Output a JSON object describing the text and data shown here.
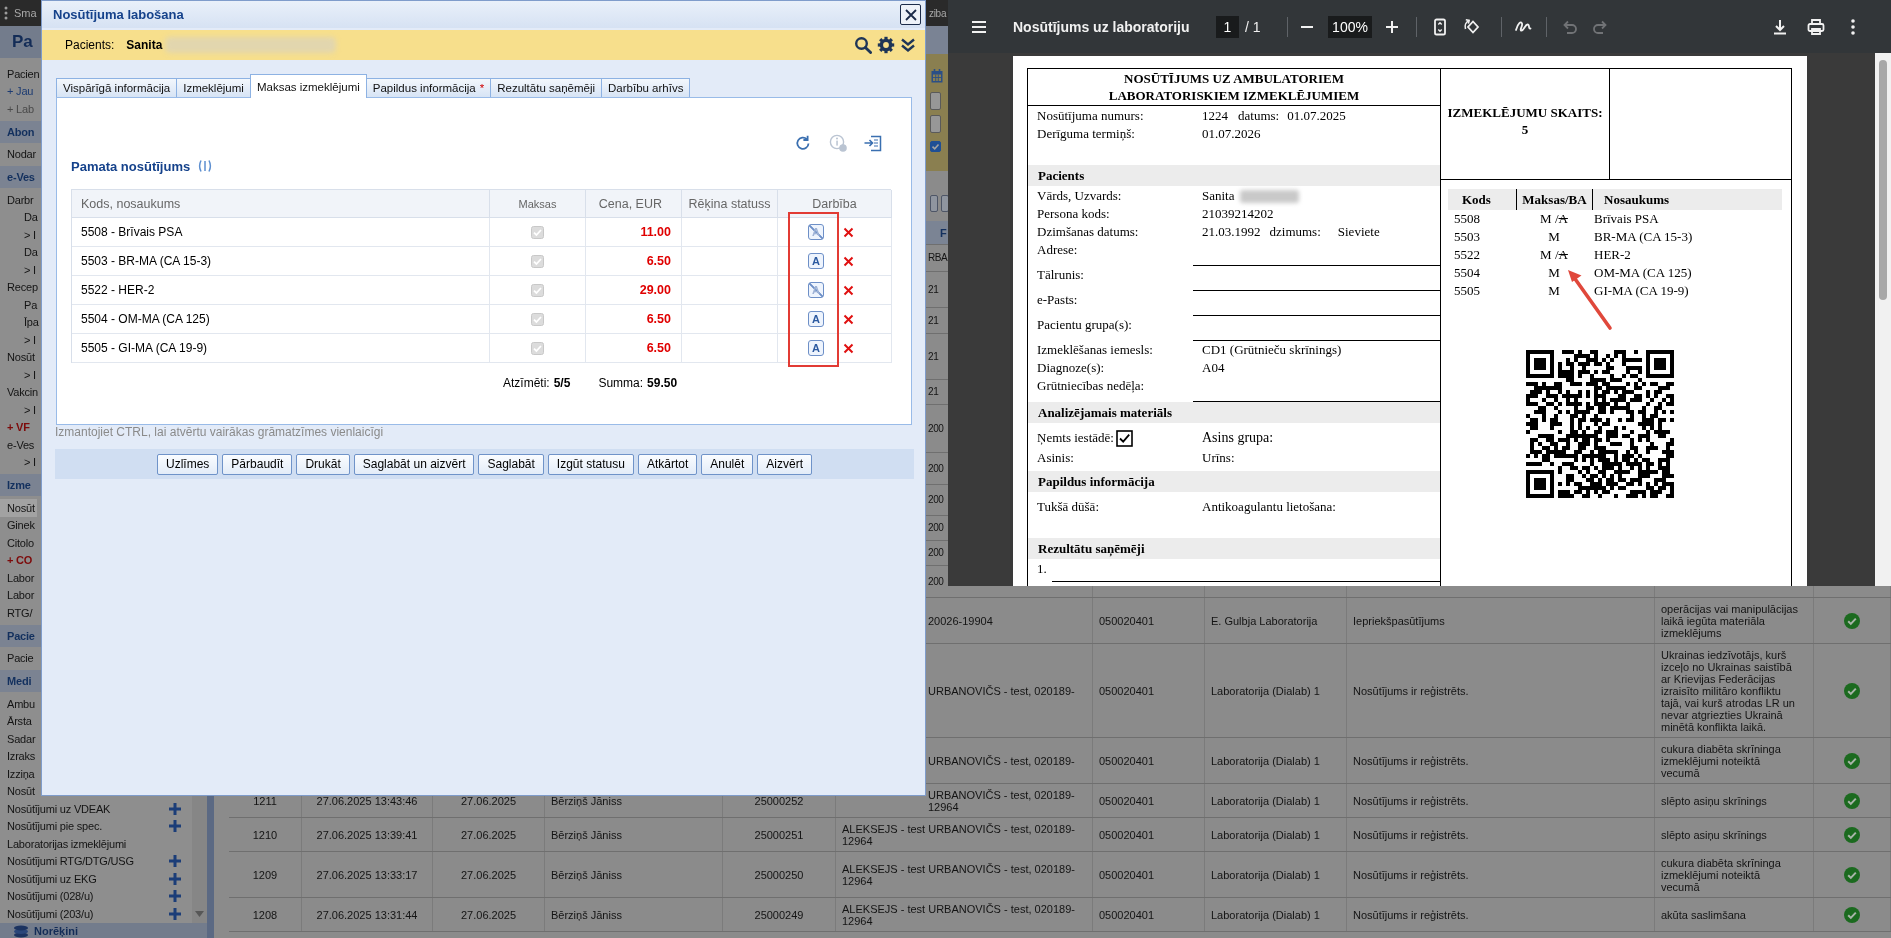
{
  "app": {
    "top_bar": {
      "title": "Sma",
      "right_text": "ziba"
    },
    "sidebar_title": "Pa",
    "sidebar": [
      {
        "text": "Pacien",
        "kind": "item",
        "selected": false
      },
      {
        "text": "+ Jau",
        "kind": "link",
        "selected": false
      },
      {
        "text": "+ Lab",
        "kind": "muted",
        "selected": false
      },
      {
        "text": "Abon",
        "kind": "header",
        "selected": false
      },
      {
        "text": "Nodar",
        "kind": "item",
        "selected": false
      },
      {
        "text": "e-Ves",
        "kind": "header",
        "selected": false
      },
      {
        "text": "Darbr",
        "kind": "item",
        "selected": false
      },
      {
        "text": "Da",
        "kind": "sub",
        "selected": false
      },
      {
        "text": "> I",
        "kind": "sub",
        "selected": false
      },
      {
        "text": "Da",
        "kind": "sub",
        "selected": false
      },
      {
        "text": "> I",
        "kind": "sub",
        "selected": false
      },
      {
        "text": "Recep",
        "kind": "item",
        "selected": false
      },
      {
        "text": "Pa",
        "kind": "sub",
        "selected": false
      },
      {
        "text": "Īpa",
        "kind": "sub",
        "selected": false
      },
      {
        "text": "> I",
        "kind": "sub",
        "selected": false
      },
      {
        "text": "Nosūt",
        "kind": "item",
        "selected": false
      },
      {
        "text": "> I",
        "kind": "sub",
        "selected": false
      },
      {
        "text": "Vakcin",
        "kind": "item",
        "selected": false
      },
      {
        "text": "> I",
        "kind": "sub",
        "selected": false
      },
      {
        "text": "+ VF",
        "kind": "alert",
        "selected": false
      },
      {
        "text": "e-Ves",
        "kind": "item",
        "selected": false
      },
      {
        "text": "> I",
        "kind": "sub",
        "selected": false
      },
      {
        "text": "Izme",
        "kind": "header",
        "selected": false
      },
      {
        "text": "Nosūt",
        "kind": "item",
        "selected": true
      },
      {
        "text": "Ginek",
        "kind": "item",
        "selected": false
      },
      {
        "text": "Citolo",
        "kind": "item",
        "selected": false
      },
      {
        "text": "+ CO",
        "kind": "alert",
        "selected": false
      },
      {
        "text": "Labor",
        "kind": "item",
        "selected": false
      },
      {
        "text": "Labor",
        "kind": "item",
        "selected": false
      },
      {
        "text": "RTG/",
        "kind": "item",
        "selected": false
      },
      {
        "text": "Pacie",
        "kind": "header",
        "selected": false
      },
      {
        "text": "Pacie",
        "kind": "item",
        "selected": false
      },
      {
        "text": "Medi",
        "kind": "header",
        "selected": false
      },
      {
        "text": "Ambu",
        "kind": "item",
        "selected": false
      },
      {
        "text": "Ārsta",
        "kind": "item",
        "selected": false
      },
      {
        "text": "Sadar",
        "kind": "item",
        "selected": false
      },
      {
        "text": "Izraks",
        "kind": "item",
        "selected": false
      },
      {
        "text": "Izziņa",
        "kind": "item",
        "selected": false
      },
      {
        "text": "Nosūt",
        "kind": "item",
        "selected": false
      },
      {
        "text": "Nosūtījumi uz VDEAK",
        "kind": "item",
        "selected": false,
        "add": true
      },
      {
        "text": "Nosūtījumi pie spec.",
        "kind": "item",
        "selected": false,
        "add": true
      },
      {
        "text": "Laboratorijas izmeklējumi",
        "kind": "item",
        "selected": false,
        "add": false
      },
      {
        "text": "Nosūtījumi RTG/DTG/USG",
        "kind": "item",
        "selected": false,
        "add": true
      },
      {
        "text": "Nosūtījumi uz EKG",
        "kind": "item",
        "selected": false,
        "add": true
      },
      {
        "text": "Nosūtījumi (028/u)",
        "kind": "item",
        "selected": false,
        "add": true
      },
      {
        "text": "Nosūtījumi (203/u)",
        "kind": "item",
        "selected": false,
        "add": true
      }
    ],
    "sidebar_footer": "Norēķini",
    "strip": {
      "checkbox_checked": true
    },
    "table_header": {
      "column_6": "F"
    },
    "table_rows": [
      {
        "kind": "covered",
        "column_6": [
          "RBA"
        ]
      },
      {
        "kind": "covered",
        "column_6": [
          "21"
        ]
      },
      {
        "kind": "covered",
        "column_6": [
          "21"
        ]
      },
      {
        "kind": "covered",
        "column_6": [
          "21"
        ]
      },
      {
        "kind": "covered",
        "column_6": [
          "21"
        ]
      },
      {
        "kind": "covered",
        "column_6": [
          "200"
        ]
      },
      {
        "kind": "covered",
        "column_6": [
          "200"
        ]
      },
      {
        "kind": "covered",
        "column_6": [
          "200"
        ]
      },
      {
        "kind": "covered",
        "column_6": [
          "200"
        ]
      },
      {
        "kind": "covered",
        "column_6": [
          "200"
        ]
      },
      {
        "kind": "covered",
        "column_6": [
          "200"
        ]
      },
      {
        "kind": "partial",
        "column_6": [
          "20026-19904"
        ],
        "column_7": "050020401",
        "column_8": "E. Gulbja Laboratorija",
        "column_9": "Iepriekšpasūtījums",
        "column_10": "operācijas vai manipulācijas laikā iegūta materiāla izmeklējums"
      },
      {
        "kind": "partial",
        "column_6": [
          "URBANOVIČS - test, 020189-"
        ],
        "column_7": "050020401",
        "column_8": "Laboratorija (Dialab) 1",
        "column_9": "Nosūtījums ir reģistrēts.",
        "column_10": "Ukrainas iedzīvotājs, kurš izceļo no Ukrainas saistībā ar Krievijas Federācijas izraisīto militāro konfliktu tajā, vai kurš atrodas LR un nevar atgriezties Ukrainā minētā konflikta laikā."
      },
      {
        "kind": "partial",
        "column_6": [
          "URBANOVIČS - test, 020189-"
        ],
        "column_7": "050020401",
        "column_8": "Laboratorija (Dialab) 1",
        "column_9": "Nosūtījums ir reģistrēts.",
        "column_10": "cukura diabēta skrīninga izmeklējumi noteiktā vecumā"
      },
      {
        "kind": "partial",
        "column_1": "1211",
        "column_2": "27.06.2025 13:43:46",
        "column_3": "27.06.2025",
        "column_4": "Bērziņš Jāniss",
        "column_5": "25000252",
        "column_6": [
          "URBANOVIČS - test, 020189-",
          "12964"
        ],
        "column_7": "050020401",
        "column_8": "Laboratorija (Dialab) 1",
        "column_9": "Nosūtījums ir reģistrēts.",
        "column_10": "slēpto asiņu skrīnings"
      },
      {
        "kind": "full",
        "column_1": "1210",
        "column_2": "27.06.2025 13:39:41",
        "column_3": "27.06.2025",
        "column_4": "Bērziņš Jāniss",
        "column_5": "25000251",
        "column_6": [
          "ALEKSEJS - test URBANOVIČS - test, 020189-",
          "12964"
        ],
        "column_7": "050020401",
        "column_8": "Laboratorija (Dialab) 1",
        "column_9": "Nosūtījums ir reģistrēts.",
        "column_10": "slēpto asiņu skrīnings"
      },
      {
        "kind": "full",
        "column_1": "1209",
        "column_2": "27.06.2025 13:33:17",
        "column_3": "27.06.2025",
        "column_4": "Bērziņš Jāniss",
        "column_5": "25000250",
        "column_6": [
          "ALEKSEJS - test URBANOVIČS - test, 020189-",
          "12964"
        ],
        "column_7": "050020401",
        "column_8": "Laboratorija (Dialab) 1",
        "column_9": "Nosūtījums ir reģistrēts.",
        "column_10": "cukura diabēta skrīninga izmeklējumi noteiktā vecumā"
      },
      {
        "kind": "full",
        "column_1": "1208",
        "column_2": "27.06.2025 13:31:44",
        "column_3": "27.06.2025",
        "column_4": "Bērziņš Jāniss",
        "column_5": "25000249",
        "column_6": [
          "ALEKSEJS - test URBANOVIČS - test, 020189-",
          "12964"
        ],
        "column_7": "050020401",
        "column_8": "Laboratorija (Dialab) 1",
        "column_9": "Nosūtījums ir reģistrēts.",
        "column_10": "akūta saslimšana"
      }
    ]
  },
  "dialog": {
    "title": "Nosūtījuma labošana",
    "patient_label": "Pacients:",
    "patient_name": "Sanita",
    "patient_surname_blurred": true,
    "tabs": [
      {
        "label": "Vispārīgā informācija",
        "selected": false
      },
      {
        "label": "Izmeklējumi",
        "selected": false
      },
      {
        "label": "Maksas izmeklējumi",
        "selected": true
      },
      {
        "label": "Papildus informācija",
        "marker": "*",
        "selected": false
      },
      {
        "label": "Rezultātu saņēmēji",
        "selected": false
      },
      {
        "label": "Darbību arhīvs",
        "selected": false
      }
    ],
    "info_disabled": true,
    "section_title": "Pamata nosūtījums",
    "columns": [
      "Kods, nosaukums",
      "Maksas",
      "Cena, EUR",
      "Rēķina statuss",
      "Darbība"
    ],
    "rows": [
      {
        "label": "5508 - Brīvais PSA",
        "checked": true,
        "disabled": true,
        "price": "11.00",
        "ba_letter": "A",
        "ba_crossed": true
      },
      {
        "label": "5503 - BR-MA (CA 15-3)",
        "checked": true,
        "disabled": true,
        "price": "6.50",
        "ba_letter": "A",
        "ba_crossed": false
      },
      {
        "label": "5522 - HER-2",
        "checked": true,
        "disabled": true,
        "price": "29.00",
        "ba_letter": "A",
        "ba_crossed": true
      },
      {
        "label": "5504 - OM-MA (CA 125)",
        "checked": true,
        "disabled": true,
        "price": "6.50",
        "ba_letter": "A",
        "ba_crossed": false
      },
      {
        "label": "5505 - GI-MA (CA 19-9)",
        "checked": true,
        "disabled": true,
        "price": "6.50",
        "ba_letter": "A",
        "ba_crossed": false
      }
    ],
    "summary": [
      {
        "label": "Atzīmēti:",
        "value": "5/5"
      },
      {
        "label": "Summa:",
        "value": "59.50"
      }
    ],
    "hint": "Izmantojiet CTRL, lai atvērtu vairākas grāmatzīmes vienlaicīgi",
    "buttons": [
      "Uzlīmes",
      "Pārbaudīt",
      "Drukāt",
      "Saglabāt un aizvērt",
      "Saglabāt",
      "Izgūt statusu",
      "Atkārtot",
      "Anulēt",
      "Aizvērt"
    ]
  },
  "pdf_viewer": {
    "title": "Nosūtījums uz laboratoriju",
    "page": "1",
    "page_total": "/ 1",
    "zoom": "100%",
    "undo_disabled": true,
    "redo_disabled": true,
    "document": {
      "title_lines": [
        "NOSŪTĪJUMS UZ AMBULATORIEM",
        "LABORATORISKIEM IZMEKLĒJUMIEM"
      ],
      "meta_rows": [
        {
          "label": "Nosūtījuma numurs:",
          "value": "1224",
          "extra_label": "datums:",
          "extra_value": "01.07.2025"
        },
        {
          "label": "Derīguma termiņš:",
          "value": "01.07.2026"
        }
      ],
      "count_label": "IZMEKLĒJUMU SKAITS:",
      "count": "5",
      "sections": [
        {
          "heading": "Pacients",
          "rows": [
            {
              "kind": "value",
              "label": "Vārds, Uzvards:",
              "value": "Sanita",
              "surname_blurred": true
            },
            {
              "kind": "value",
              "label": "Persona kods:",
              "value": "21039214202"
            },
            {
              "kind": "value",
              "label": "Dzimšanas datums:",
              "value": "21.03.1992",
              "extra_label": "dzimums:",
              "extra_value": "Sieviete"
            },
            {
              "kind": "blank",
              "label": "Adrese:"
            },
            {
              "kind": "blank",
              "label": "Tālrunis:"
            },
            {
              "kind": "blank",
              "label": "e-Pasts:"
            },
            {
              "kind": "blank",
              "label": "Pacientu grupa(s):"
            },
            {
              "kind": "value",
              "label": "Izmeklēšanas iemesls:",
              "value": "CD1 (Grūtnieču skrīnings)"
            },
            {
              "kind": "value",
              "label": "Diagnoze(s):",
              "value": "A04"
            },
            {
              "kind": "blank",
              "label": "Grūtniecības nedēļa:"
            }
          ]
        },
        {
          "heading": "Analizējamais materiāls",
          "rows": [
            {
              "kind": "check",
              "label": "Ņemts iestādē:",
              "checked": true,
              "second_label": "Asins grupa:"
            },
            {
              "kind": "pair",
              "label": "Asinis:",
              "second_label": "Urīns:"
            }
          ]
        },
        {
          "heading": "Papildus informācija",
          "rows": [
            {
              "kind": "pair",
              "label": "Tukšā dūšā:",
              "second_label": "Antikoagulantu lietošana:"
            }
          ]
        },
        {
          "heading": "Rezultātu saņēmēji",
          "rows": [
            {
              "kind": "numbered",
              "label": "1."
            }
          ]
        }
      ],
      "tests_columns": [
        "Kods",
        "Maksas/BA",
        "Nosaukums"
      ],
      "tests": [
        {
          "code": "5508",
          "payment": "M /",
          "ba": "A",
          "ba_struck": true,
          "name": "Brīvais PSA"
        },
        {
          "code": "5503",
          "payment": "M",
          "name": "BR-MA (CA 15-3)"
        },
        {
          "code": "5522",
          "payment": "M /",
          "ba": "A",
          "ba_struck": true,
          "name": "HER-2"
        },
        {
          "code": "5504",
          "payment": "M",
          "name": "OM-MA (CA 125)"
        },
        {
          "code": "5505",
          "payment": "M",
          "name": "GI-MA (CA 19-9)"
        }
      ]
    }
  }
}
